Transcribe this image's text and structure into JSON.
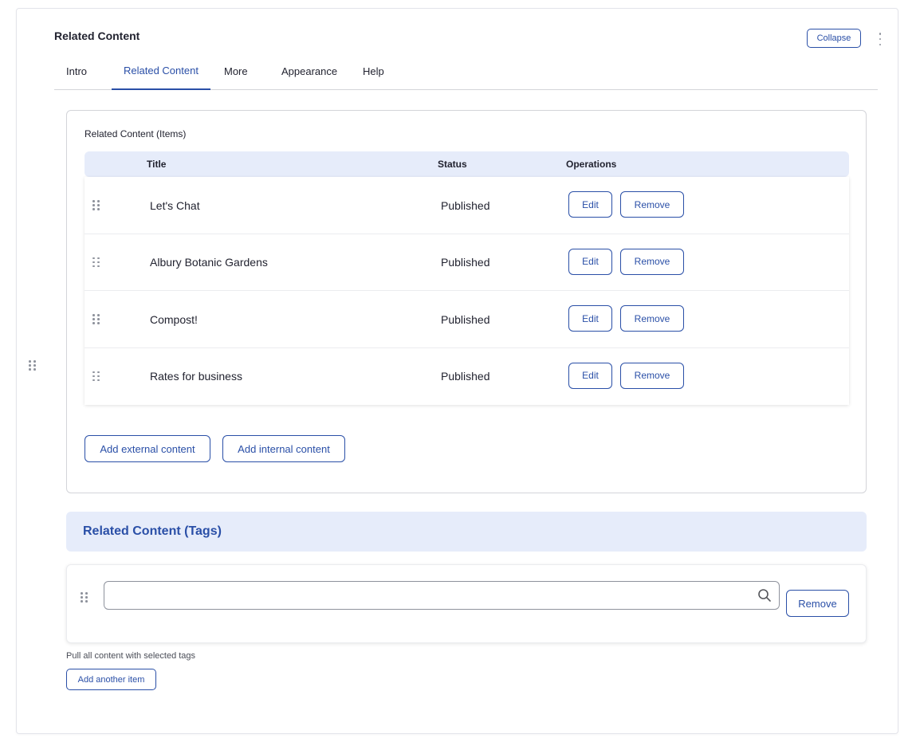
{
  "header": {
    "title": "Related Content",
    "collapse_label": "Collapse"
  },
  "tabs": [
    {
      "label": "Intro"
    },
    {
      "label": "Related Content",
      "active": true
    },
    {
      "label": "More"
    },
    {
      "label": "Appearance"
    },
    {
      "label": "Help"
    }
  ],
  "items_section": {
    "label": "Related Content (Items)",
    "columns": {
      "title": "Title",
      "status": "Status",
      "operations": "Operations"
    },
    "rows": [
      {
        "title": "Let's Chat",
        "status": "Published",
        "edit": "Edit",
        "remove": "Remove"
      },
      {
        "title": "Albury Botanic Gardens",
        "status": "Published",
        "edit": "Edit",
        "remove": "Remove"
      },
      {
        "title": "Compost!",
        "status": "Published",
        "edit": "Edit",
        "remove": "Remove"
      },
      {
        "title": "Rates for business",
        "status": "Published",
        "edit": "Edit",
        "remove": "Remove"
      }
    ],
    "add_external_label": "Add external content",
    "add_internal_label": "Add internal content"
  },
  "tags_section": {
    "title": "Related Content (Tags)",
    "input_value": "",
    "remove_label": "Remove",
    "help_text": "Pull all content with selected tags",
    "add_another_label": "Add another item"
  },
  "colors": {
    "accent": "#2a4fa7",
    "header_bg": "#e6ecfa",
    "border": "#d3d4d9"
  }
}
